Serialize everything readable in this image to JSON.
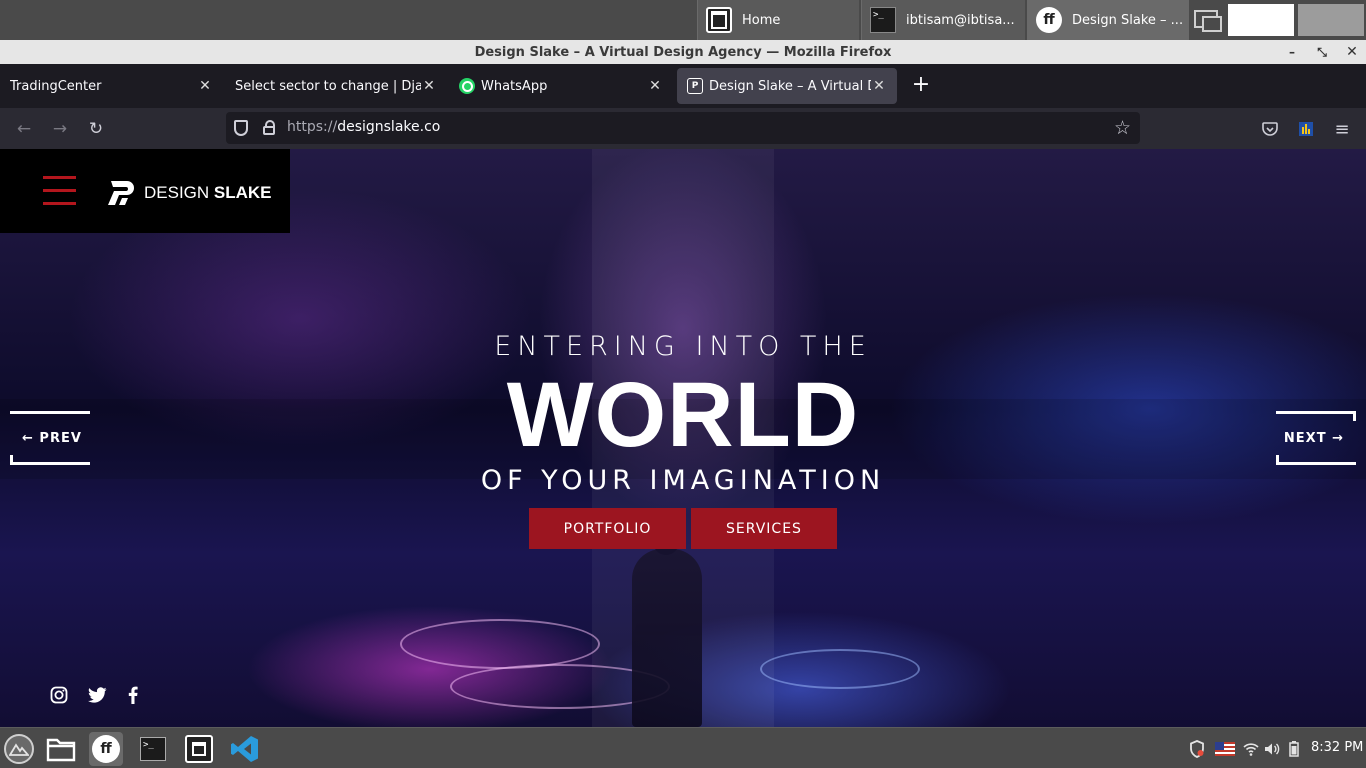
{
  "system_panel": {
    "tasks": [
      {
        "label": "Home",
        "icon": "files-icon"
      },
      {
        "label": "ibtisam@ibtisa...",
        "icon": "terminal-icon"
      },
      {
        "label": "Design Slake – ...",
        "icon": "firefox-icon"
      }
    ]
  },
  "window": {
    "title": "Design Slake – A Virtual Design Agency — Mozilla Firefox"
  },
  "browser": {
    "tabs": [
      {
        "title": "TradingCenter",
        "active": false
      },
      {
        "title": "Select sector to change | Django site admin",
        "active": false
      },
      {
        "title": "WhatsApp",
        "active": false,
        "favicon": "whatsapp-icon"
      },
      {
        "title": "Design Slake – A Virtual Design Agency",
        "active": true,
        "favicon": "design-slake-icon"
      }
    ],
    "url_scheme": "https://",
    "url_host": "designslake.co"
  },
  "site": {
    "logo_light": "DESIGN ",
    "logo_bold": "SLAKE",
    "hero": {
      "line1": "ENTERING INTO THE",
      "line2": "WORLD",
      "line3": "OF YOUR IMAGINATION"
    },
    "buttons": {
      "portfolio": "PORTFOLIO",
      "services": "SERVICES"
    },
    "slider": {
      "prev": "← PREV",
      "next": "NEXT →"
    },
    "social": [
      "instagram-icon",
      "twitter-icon",
      "facebook-icon"
    ],
    "accent_color": "#9c1520"
  },
  "taskbar": {
    "clock": "8:32 PM",
    "tray_icons": [
      "shield-icon",
      "us-flag-icon",
      "wifi-icon",
      "volume-icon",
      "battery-icon"
    ]
  }
}
